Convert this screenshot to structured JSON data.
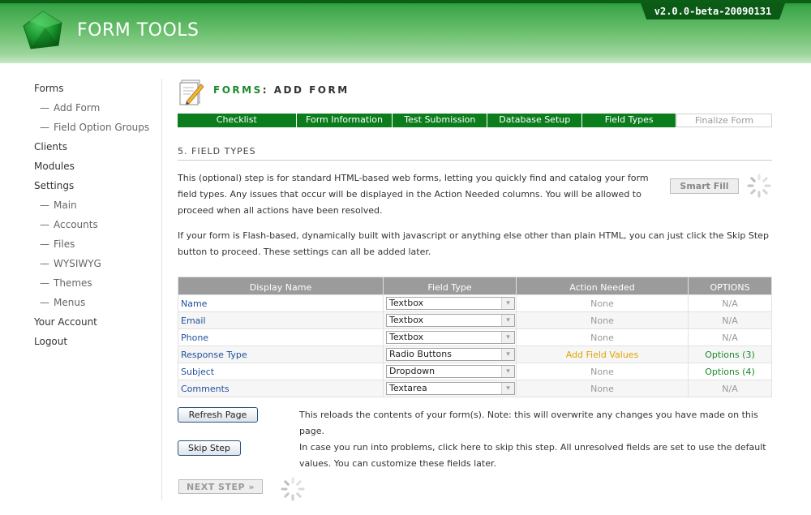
{
  "app": {
    "title": "FORM TOOLS",
    "version": "v2.0.0-beta-20090131"
  },
  "sidebar": {
    "items": [
      {
        "label": "Forms",
        "sub": false
      },
      {
        "label": "Add Form",
        "sub": true
      },
      {
        "label": "Field Option Groups",
        "sub": true
      },
      {
        "label": "Clients",
        "sub": false
      },
      {
        "label": "Modules",
        "sub": false
      },
      {
        "label": "Settings",
        "sub": false
      },
      {
        "label": "Main",
        "sub": true
      },
      {
        "label": "Accounts",
        "sub": true
      },
      {
        "label": "Files",
        "sub": true
      },
      {
        "label": "WYSIWYG",
        "sub": true
      },
      {
        "label": "Themes",
        "sub": true
      },
      {
        "label": "Menus",
        "sub": true
      },
      {
        "label": "Your Account",
        "sub": false
      },
      {
        "label": "Logout",
        "sub": false
      }
    ]
  },
  "page": {
    "title_prefix": "FORMS",
    "title_rest": ": ADD FORM"
  },
  "steps": [
    {
      "label": "Checklist",
      "active": true
    },
    {
      "label": "Form Information",
      "active": true
    },
    {
      "label": "Test Submission",
      "active": true
    },
    {
      "label": "Database Setup",
      "active": true
    },
    {
      "label": "Field Types",
      "active": true
    },
    {
      "label": "Finalize Form",
      "active": false
    }
  ],
  "section": {
    "title": "5. FIELD TYPES",
    "para1": "This (optional) step is for standard HTML-based web forms, letting you quickly find and catalog your form field types. Any issues that occur will be displayed in the Action Needed columns. You will be allowed to proceed when all actions have been resolved.",
    "para2": "If your form is Flash-based, dynamically built with javascript or anything else other than plain HTML, you can just click the Skip Step button to proceed. These settings can all be added later.",
    "smart_fill": "Smart Fill"
  },
  "table": {
    "headers": [
      "Display Name",
      "Field Type",
      "Action Needed",
      "OPTIONS"
    ],
    "rows": [
      {
        "name": "Name",
        "type": "Textbox",
        "action": "None",
        "options": "N/A"
      },
      {
        "name": "Email",
        "type": "Textbox",
        "action": "None",
        "options": "N/A"
      },
      {
        "name": "Phone",
        "type": "Textbox",
        "action": "None",
        "options": "N/A"
      },
      {
        "name": "Response Type",
        "type": "Radio Buttons",
        "action": "Add Field Values",
        "options": "Options (3)"
      },
      {
        "name": "Subject",
        "type": "Dropdown",
        "action": "None",
        "options": "Options (4)"
      },
      {
        "name": "Comments",
        "type": "Textarea",
        "action": "None",
        "options": "N/A"
      }
    ]
  },
  "actions": {
    "refresh_label": "Refresh Page",
    "refresh_desc": "This reloads the contents of your form(s). Note: this will overwrite any changes you have made on this page.",
    "skip_label": "Skip Step",
    "skip_desc": "In case you run into problems, click here to skip this step. All unresolved fields are set to use the default values. You can customize these fields later.",
    "next_label": "NEXT STEP »"
  },
  "colors": {
    "brand_green": "#0b7d1d",
    "link_blue": "#1e4f9a",
    "warn_orange": "#e0a400"
  }
}
